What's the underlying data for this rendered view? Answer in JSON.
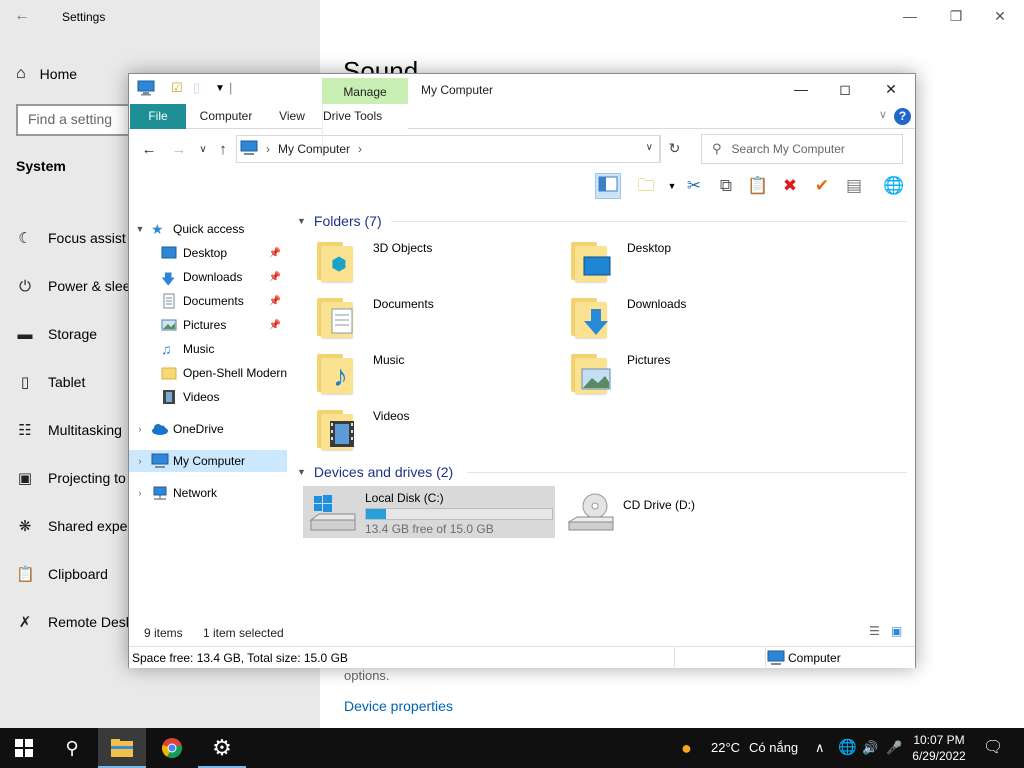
{
  "settings": {
    "title": "Settings",
    "home": "Home",
    "search_placeholder": "Find a setting",
    "section": "System",
    "nav_items": [
      "Focus assist",
      "Power & sleep",
      "Storage",
      "Tablet",
      "Multitasking",
      "Projecting to",
      "Shared exper",
      "Clipboard",
      "Remote Desk"
    ],
    "page_title": "Sound",
    "options_text": "options.",
    "device_properties_link": "Device properties"
  },
  "explorer": {
    "title": "My Computer",
    "manage_tab": "Manage",
    "ribbon_tabs": {
      "file": "File",
      "computer": "Computer",
      "view": "View",
      "drive_tools": "Drive Tools"
    },
    "address": {
      "crumb": "My Computer"
    },
    "search_placeholder": "Search My Computer",
    "nav": {
      "quick_access": "Quick access",
      "quick_items": [
        "Desktop",
        "Downloads",
        "Documents",
        "Pictures",
        "Music",
        "Open-Shell Modern",
        "Videos"
      ],
      "onedrive": "OneDrive",
      "my_computer": "My Computer",
      "network": "Network"
    },
    "folders_header": "Folders (7)",
    "folders": [
      "3D Objects",
      "Desktop",
      "Documents",
      "Downloads",
      "Music",
      "Pictures",
      "Videos"
    ],
    "devices_header": "Devices and drives (2)",
    "drives": [
      {
        "name": "Local Disk (C:)",
        "free_text": "13.4 GB free of 15.0 GB",
        "used_fraction": 0.107
      },
      {
        "name": "CD Drive (D:)"
      }
    ],
    "status": {
      "items": "9 items",
      "selected": "1 item selected"
    },
    "details": {
      "space": "Space free: 13.4 GB, Total size: 15.0 GB",
      "location": "Computer"
    }
  },
  "taskbar": {
    "weather": "22°C",
    "weather_desc": "Có nắng",
    "time": "10:07 PM",
    "date": "6/29/2022"
  },
  "colors": {
    "accent": "#1e8f94",
    "manage": "#c9eeb4",
    "link": "#0063b1",
    "selection": "#cce8ff"
  }
}
